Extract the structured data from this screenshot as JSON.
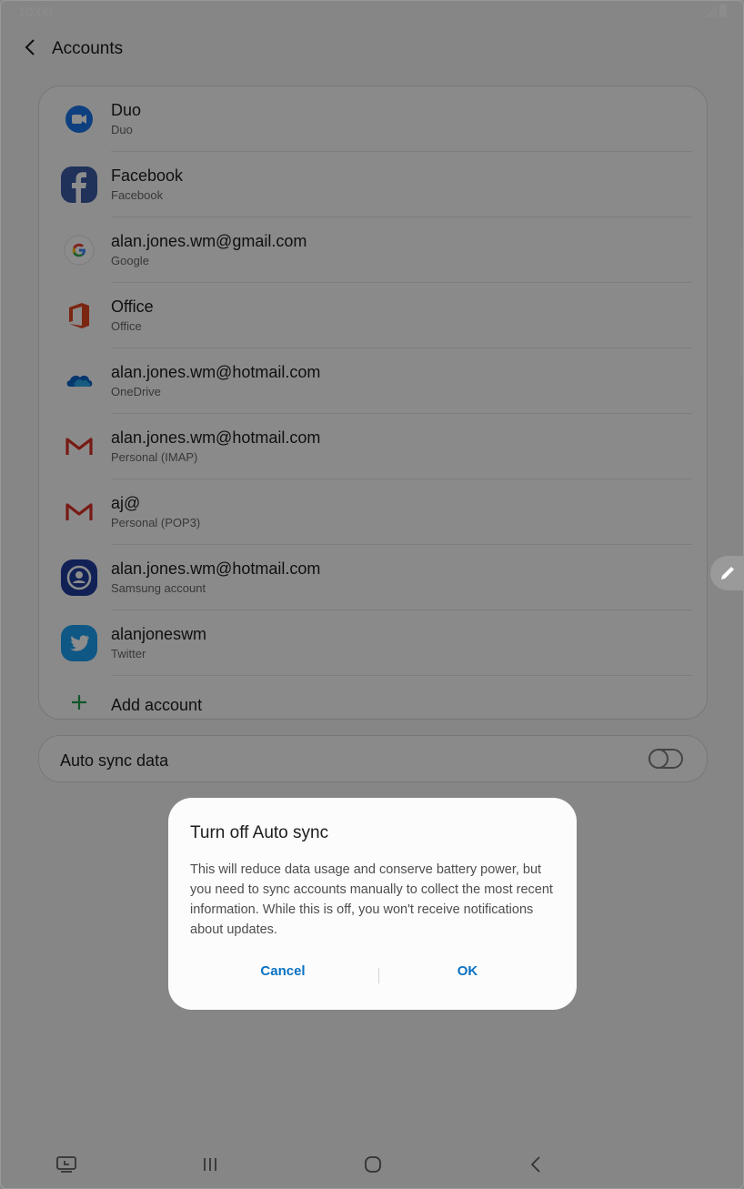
{
  "status": {
    "time": "10:00"
  },
  "header": {
    "title": "Accounts"
  },
  "accounts": [
    {
      "name": "Duo",
      "type": "Duo",
      "icon": "duo-icon"
    },
    {
      "name": "Facebook",
      "type": "Facebook",
      "icon": "facebook-icon"
    },
    {
      "name": "alan.jones.wm@gmail.com",
      "type": "Google",
      "icon": "google-icon"
    },
    {
      "name": "Office",
      "type": "Office",
      "icon": "office-icon"
    },
    {
      "name": "alan.jones.wm@hotmail.com",
      "type": "OneDrive",
      "icon": "onedrive-icon"
    },
    {
      "name": "alan.jones.wm@hotmail.com",
      "type": "Personal (IMAP)",
      "icon": "gmail-icon"
    },
    {
      "name": "aj@",
      "type": "Personal (POP3)",
      "icon": "gmail-icon"
    },
    {
      "name": "alan.jones.wm@hotmail.com",
      "type": "Samsung account",
      "icon": "samsung-account-icon"
    },
    {
      "name": "alanjoneswm",
      "type": "Twitter",
      "icon": "twitter-icon"
    }
  ],
  "add_account": {
    "label": "Add account"
  },
  "auto_sync": {
    "label": "Auto sync data",
    "enabled": false
  },
  "dialog": {
    "title": "Turn off Auto sync",
    "body": "This will reduce data usage and conserve battery power, but you need to sync accounts manually to collect the most recent information. While this is off, you won't receive notifications about updates.",
    "cancel_label": "Cancel",
    "ok_label": "OK"
  },
  "colors": {
    "accent": "#0a72c2",
    "scrim": "rgba(0,0,0,0.45)"
  }
}
